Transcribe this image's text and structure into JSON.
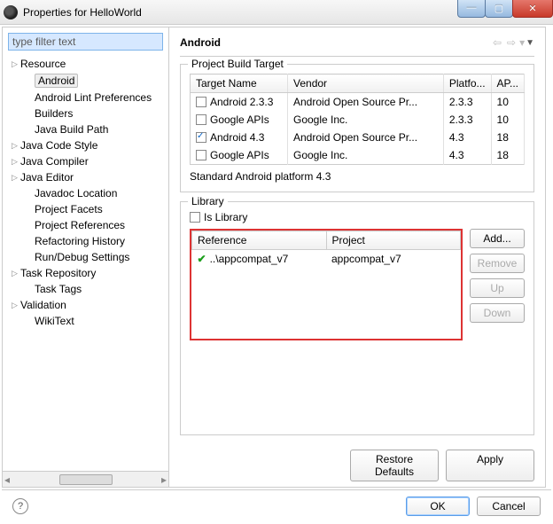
{
  "window": {
    "title": "Properties for HelloWorld"
  },
  "filter": {
    "placeholder": "type filter text"
  },
  "tree": {
    "items": [
      {
        "label": "Resource",
        "level": 0,
        "expandable": true
      },
      {
        "label": "Android",
        "level": 1,
        "selected": true
      },
      {
        "label": "Android Lint Preferences",
        "level": 1
      },
      {
        "label": "Builders",
        "level": 1
      },
      {
        "label": "Java Build Path",
        "level": 1
      },
      {
        "label": "Java Code Style",
        "level": 0,
        "expandable": true
      },
      {
        "label": "Java Compiler",
        "level": 0,
        "expandable": true
      },
      {
        "label": "Java Editor",
        "level": 0,
        "expandable": true
      },
      {
        "label": "Javadoc Location",
        "level": 1
      },
      {
        "label": "Project Facets",
        "level": 1
      },
      {
        "label": "Project References",
        "level": 1
      },
      {
        "label": "Refactoring History",
        "level": 1
      },
      {
        "label": "Run/Debug Settings",
        "level": 1
      },
      {
        "label": "Task Repository",
        "level": 0,
        "expandable": true
      },
      {
        "label": "Task Tags",
        "level": 1
      },
      {
        "label": "Validation",
        "level": 0,
        "expandable": true
      },
      {
        "label": "WikiText",
        "level": 1
      }
    ]
  },
  "page": {
    "title": "Android",
    "build_target_group": "Project Build Target",
    "target_headers": {
      "name": "Target Name",
      "vendor": "Vendor",
      "platform": "Platfo...",
      "api": "AP..."
    },
    "targets": [
      {
        "name": "Android 2.3.3",
        "vendor": "Android Open Source Pr...",
        "platform": "2.3.3",
        "api": "10",
        "checked": false
      },
      {
        "name": "Google APIs",
        "vendor": "Google Inc.",
        "platform": "2.3.3",
        "api": "10",
        "checked": false
      },
      {
        "name": "Android 4.3",
        "vendor": "Android Open Source Pr...",
        "platform": "4.3",
        "api": "18",
        "checked": true
      },
      {
        "name": "Google APIs",
        "vendor": "Google Inc.",
        "platform": "4.3",
        "api": "18",
        "checked": false
      }
    ],
    "standard_text": "Standard Android platform 4.3",
    "library_group": "Library",
    "is_library_label": "Is Library",
    "lib_headers": {
      "reference": "Reference",
      "project": "Project"
    },
    "lib_rows": [
      {
        "ref": "..\\appcompat_v7",
        "project": "appcompat_v7",
        "ok": true
      }
    ],
    "buttons": {
      "add": "Add...",
      "remove": "Remove",
      "up": "Up",
      "down": "Down"
    },
    "restore": "Restore Defaults",
    "apply": "Apply"
  },
  "footer": {
    "ok": "OK",
    "cancel": "Cancel"
  }
}
